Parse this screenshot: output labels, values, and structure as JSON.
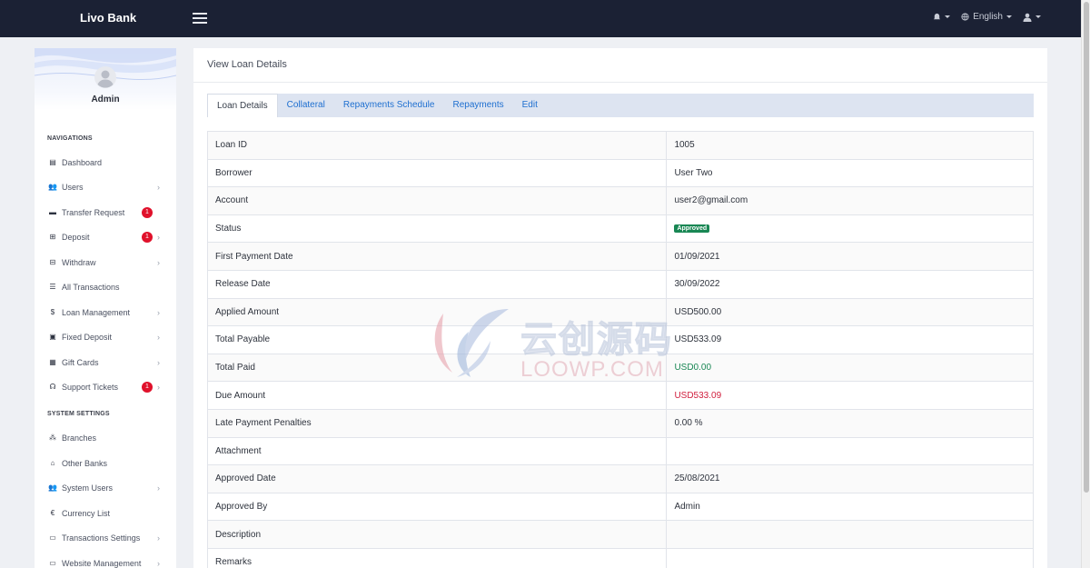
{
  "brand": "Livo Bank",
  "topbar": {
    "language": "English"
  },
  "sidebar": {
    "admin_name": "Admin",
    "navigations_title": "NAVIGATIONS",
    "system_settings_title": "SYSTEM SETTINGS",
    "items": [
      {
        "label": "Dashboard"
      },
      {
        "label": "Users"
      },
      {
        "label": "Transfer Request",
        "badge": "1"
      },
      {
        "label": "Deposit",
        "badge": "1"
      },
      {
        "label": "Withdraw"
      },
      {
        "label": "All Transactions"
      },
      {
        "label": "Loan Management"
      },
      {
        "label": "Fixed Deposit"
      },
      {
        "label": "Gift Cards"
      },
      {
        "label": "Support Tickets",
        "badge": "1"
      }
    ],
    "settings_items": [
      {
        "label": "Branches"
      },
      {
        "label": "Other Banks"
      },
      {
        "label": "System Users"
      },
      {
        "label": "Currency List"
      },
      {
        "label": "Transactions Settings"
      },
      {
        "label": "Website Management"
      }
    ]
  },
  "main": {
    "title": "View Loan Details",
    "tabs": [
      {
        "label": "Loan Details"
      },
      {
        "label": "Collateral"
      },
      {
        "label": "Repayments Schedule"
      },
      {
        "label": "Repayments"
      },
      {
        "label": "Edit"
      }
    ],
    "rows": [
      {
        "label": "Loan ID",
        "value": "1005"
      },
      {
        "label": "Borrower",
        "value": "User Two"
      },
      {
        "label": "Account",
        "value": "user2@gmail.com"
      },
      {
        "label": "Status",
        "value": "Approved"
      },
      {
        "label": "First Payment Date",
        "value": "01/09/2021"
      },
      {
        "label": "Release Date",
        "value": "30/09/2022"
      },
      {
        "label": "Applied Amount",
        "value": "USD500.00"
      },
      {
        "label": "Total Payable",
        "value": "USD533.09"
      },
      {
        "label": "Total Paid",
        "value": "USD0.00"
      },
      {
        "label": "Due Amount",
        "value": "USD533.09"
      },
      {
        "label": "Late Payment Penalties",
        "value": "0.00 %"
      },
      {
        "label": "Attachment",
        "value": ""
      },
      {
        "label": "Approved Date",
        "value": "25/08/2021"
      },
      {
        "label": "Approved By",
        "value": "Admin"
      },
      {
        "label": "Description",
        "value": ""
      },
      {
        "label": "Remarks",
        "value": ""
      }
    ]
  },
  "watermark": {
    "cn": "云创源码",
    "en": "LOOWP.COM"
  },
  "colors": {
    "topbar": "#1b2134",
    "tab_link": "#1e6fd0",
    "status_green": "#198754",
    "due_red": "#d01d3c",
    "badge_red": "#e0112b"
  }
}
